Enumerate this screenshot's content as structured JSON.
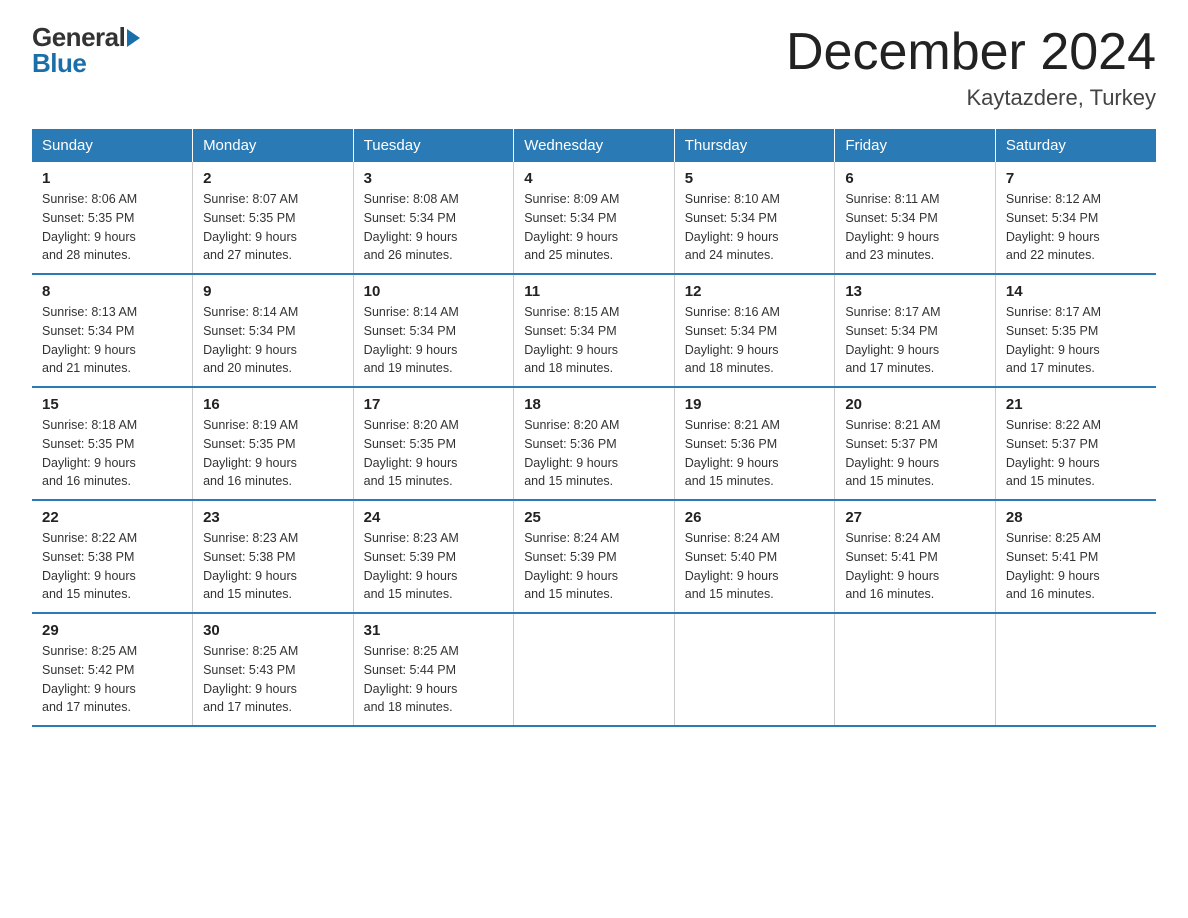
{
  "logo": {
    "top": "General",
    "bottom": "Blue"
  },
  "header": {
    "title": "December 2024",
    "subtitle": "Kaytazdere, Turkey"
  },
  "weekdays": [
    "Sunday",
    "Monday",
    "Tuesday",
    "Wednesday",
    "Thursday",
    "Friday",
    "Saturday"
  ],
  "weeks": [
    [
      {
        "day": "1",
        "info": "Sunrise: 8:06 AM\nSunset: 5:35 PM\nDaylight: 9 hours\nand 28 minutes."
      },
      {
        "day": "2",
        "info": "Sunrise: 8:07 AM\nSunset: 5:35 PM\nDaylight: 9 hours\nand 27 minutes."
      },
      {
        "day": "3",
        "info": "Sunrise: 8:08 AM\nSunset: 5:34 PM\nDaylight: 9 hours\nand 26 minutes."
      },
      {
        "day": "4",
        "info": "Sunrise: 8:09 AM\nSunset: 5:34 PM\nDaylight: 9 hours\nand 25 minutes."
      },
      {
        "day": "5",
        "info": "Sunrise: 8:10 AM\nSunset: 5:34 PM\nDaylight: 9 hours\nand 24 minutes."
      },
      {
        "day": "6",
        "info": "Sunrise: 8:11 AM\nSunset: 5:34 PM\nDaylight: 9 hours\nand 23 minutes."
      },
      {
        "day": "7",
        "info": "Sunrise: 8:12 AM\nSunset: 5:34 PM\nDaylight: 9 hours\nand 22 minutes."
      }
    ],
    [
      {
        "day": "8",
        "info": "Sunrise: 8:13 AM\nSunset: 5:34 PM\nDaylight: 9 hours\nand 21 minutes."
      },
      {
        "day": "9",
        "info": "Sunrise: 8:14 AM\nSunset: 5:34 PM\nDaylight: 9 hours\nand 20 minutes."
      },
      {
        "day": "10",
        "info": "Sunrise: 8:14 AM\nSunset: 5:34 PM\nDaylight: 9 hours\nand 19 minutes."
      },
      {
        "day": "11",
        "info": "Sunrise: 8:15 AM\nSunset: 5:34 PM\nDaylight: 9 hours\nand 18 minutes."
      },
      {
        "day": "12",
        "info": "Sunrise: 8:16 AM\nSunset: 5:34 PM\nDaylight: 9 hours\nand 18 minutes."
      },
      {
        "day": "13",
        "info": "Sunrise: 8:17 AM\nSunset: 5:34 PM\nDaylight: 9 hours\nand 17 minutes."
      },
      {
        "day": "14",
        "info": "Sunrise: 8:17 AM\nSunset: 5:35 PM\nDaylight: 9 hours\nand 17 minutes."
      }
    ],
    [
      {
        "day": "15",
        "info": "Sunrise: 8:18 AM\nSunset: 5:35 PM\nDaylight: 9 hours\nand 16 minutes."
      },
      {
        "day": "16",
        "info": "Sunrise: 8:19 AM\nSunset: 5:35 PM\nDaylight: 9 hours\nand 16 minutes."
      },
      {
        "day": "17",
        "info": "Sunrise: 8:20 AM\nSunset: 5:35 PM\nDaylight: 9 hours\nand 15 minutes."
      },
      {
        "day": "18",
        "info": "Sunrise: 8:20 AM\nSunset: 5:36 PM\nDaylight: 9 hours\nand 15 minutes."
      },
      {
        "day": "19",
        "info": "Sunrise: 8:21 AM\nSunset: 5:36 PM\nDaylight: 9 hours\nand 15 minutes."
      },
      {
        "day": "20",
        "info": "Sunrise: 8:21 AM\nSunset: 5:37 PM\nDaylight: 9 hours\nand 15 minutes."
      },
      {
        "day": "21",
        "info": "Sunrise: 8:22 AM\nSunset: 5:37 PM\nDaylight: 9 hours\nand 15 minutes."
      }
    ],
    [
      {
        "day": "22",
        "info": "Sunrise: 8:22 AM\nSunset: 5:38 PM\nDaylight: 9 hours\nand 15 minutes."
      },
      {
        "day": "23",
        "info": "Sunrise: 8:23 AM\nSunset: 5:38 PM\nDaylight: 9 hours\nand 15 minutes."
      },
      {
        "day": "24",
        "info": "Sunrise: 8:23 AM\nSunset: 5:39 PM\nDaylight: 9 hours\nand 15 minutes."
      },
      {
        "day": "25",
        "info": "Sunrise: 8:24 AM\nSunset: 5:39 PM\nDaylight: 9 hours\nand 15 minutes."
      },
      {
        "day": "26",
        "info": "Sunrise: 8:24 AM\nSunset: 5:40 PM\nDaylight: 9 hours\nand 15 minutes."
      },
      {
        "day": "27",
        "info": "Sunrise: 8:24 AM\nSunset: 5:41 PM\nDaylight: 9 hours\nand 16 minutes."
      },
      {
        "day": "28",
        "info": "Sunrise: 8:25 AM\nSunset: 5:41 PM\nDaylight: 9 hours\nand 16 minutes."
      }
    ],
    [
      {
        "day": "29",
        "info": "Sunrise: 8:25 AM\nSunset: 5:42 PM\nDaylight: 9 hours\nand 17 minutes."
      },
      {
        "day": "30",
        "info": "Sunrise: 8:25 AM\nSunset: 5:43 PM\nDaylight: 9 hours\nand 17 minutes."
      },
      {
        "day": "31",
        "info": "Sunrise: 8:25 AM\nSunset: 5:44 PM\nDaylight: 9 hours\nand 18 minutes."
      },
      null,
      null,
      null,
      null
    ]
  ]
}
